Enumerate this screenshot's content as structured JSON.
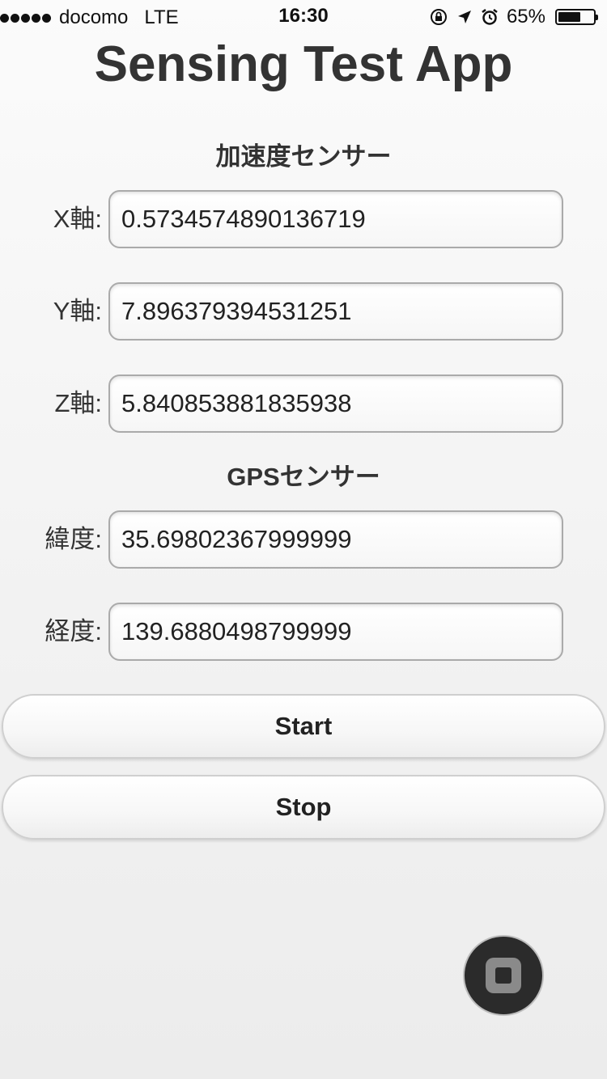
{
  "status_bar": {
    "carrier": "docomo",
    "network": "LTE",
    "time": "16:30",
    "battery_text": "65%",
    "battery_level": 0.65,
    "icons": [
      "signal-dots-icon",
      "orientation-lock-icon",
      "location-arrow-icon",
      "alarm-icon",
      "battery-icon"
    ]
  },
  "app": {
    "title": "Sensing Test App"
  },
  "accelerometer": {
    "heading": "加速度センサー",
    "x_label": "X軸:",
    "x_value": "0.5734574890136719",
    "y_label": "Y軸:",
    "y_value": "7.896379394531251",
    "z_label": "Z軸:",
    "z_value": "5.840853881835938"
  },
  "gps": {
    "heading": "GPSセンサー",
    "lat_label": "緯度:",
    "lat_value": "35.69802367999999",
    "lon_label": "経度:",
    "lon_value": "139.6880498799999"
  },
  "buttons": {
    "start_label": "Start",
    "stop_label": "Stop"
  },
  "colors": {
    "title_text": "#333333",
    "input_border": "#aaaaaa",
    "assistive_touch_bg": "#2b2b2b"
  }
}
